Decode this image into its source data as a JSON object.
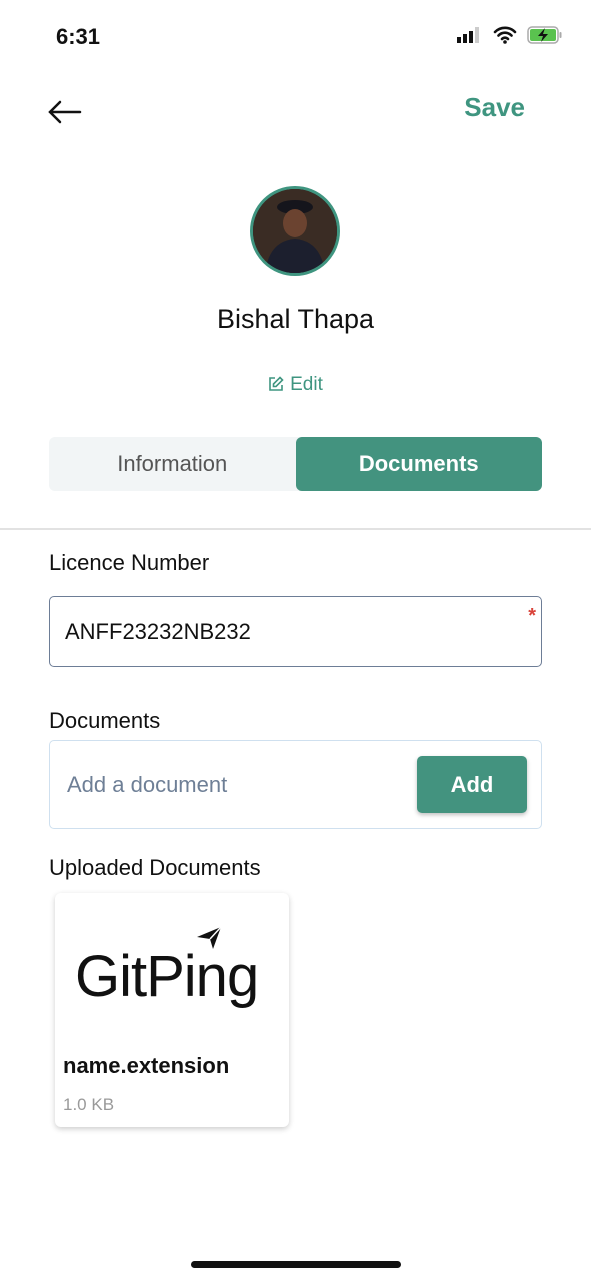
{
  "status_bar": {
    "time": "6:31",
    "icons": [
      "signal-icon",
      "wifi-icon",
      "battery-charging-icon"
    ]
  },
  "header": {
    "back_icon": "arrow-left-icon",
    "save_label": "Save"
  },
  "profile": {
    "name": "Bishal Thapa",
    "edit_label": "Edit",
    "edit_icon": "edit-icon"
  },
  "tabs": [
    {
      "label": "Information",
      "active": false
    },
    {
      "label": "Documents",
      "active": true
    }
  ],
  "form": {
    "licence_label": "Licence Number",
    "licence_value": "ANFF23232NB232",
    "required_marker": "*",
    "documents_label": "Documents",
    "documents_placeholder": "Add a document",
    "add_label": "Add"
  },
  "uploaded": {
    "label": "Uploaded Documents",
    "items": [
      {
        "logo_text": "GitPing",
        "name": "name.extension",
        "size": "1.0 KB"
      }
    ]
  },
  "colors": {
    "accent": "#43937f",
    "required": "#d9433a"
  }
}
